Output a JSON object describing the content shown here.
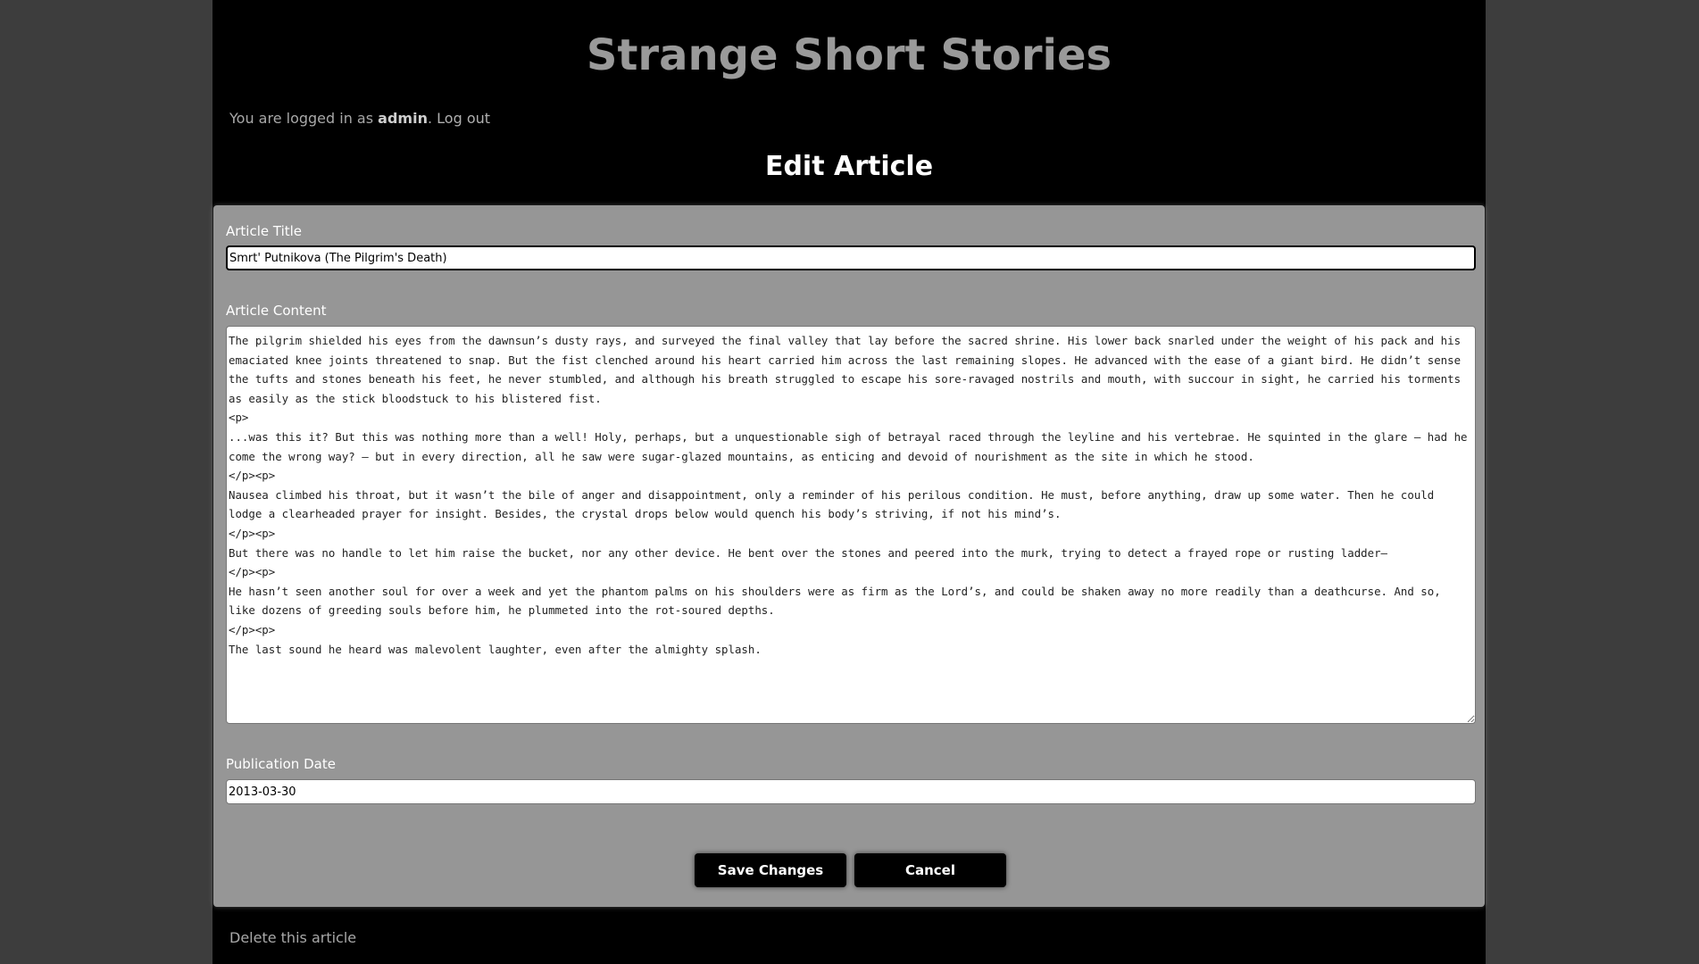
{
  "site": {
    "title": "Strange Short Stories"
  },
  "login": {
    "prefix": "You are logged in as",
    "username": "admin",
    "separator": ".",
    "logout_label": "Log out"
  },
  "page": {
    "heading": "Edit Article"
  },
  "form": {
    "title_label": "Article Title",
    "title_value": "Smrt' Putnikova (The Pilgrim's Death)",
    "content_label": "Article Content",
    "content_value": "The pilgrim shielded his eyes from the dawnsun’s dusty rays, and surveyed the final valley that lay before the sacred shrine. His lower back snarled under the weight of his pack and his emaciated knee joints threatened to snap. But the fist clenched around his heart carried him across the last remaining slopes. He advanced with the ease of a giant bird. He didn’t sense the tufts and stones beneath his feet, he never stumbled, and although his breath struggled to escape his sore-ravaged nostrils and mouth, with succour in sight, he carried his torments as easily as the stick bloodstuck to his blistered fist.\n<p>\n...was this it? But this was nothing more than a well! Holy, perhaps, but a unquestionable sigh of betrayal raced through the leyline and his vertebrae. He squinted in the glare – had he come the wrong way? – but in every direction, all he saw were sugar-glazed mountains, as enticing and devoid of nourishment as the site in which he stood.\n</p><p>\nNausea climbed his throat, but it wasn’t the bile of anger and disappointment, only a reminder of his perilous condition. He must, before anything, draw up some water. Then he could lodge a clearheaded prayer for insight. Besides, the crystal drops below would quench his body’s striving, if not his mind’s.\n</p><p>\nBut there was no handle to let him raise the bucket, nor any other device. He bent over the stones and peered into the murk, trying to detect a frayed rope or rusting ladder–\n</p><p>\nHe hasn’t seen another soul for over a week and yet the phantom palms on his shoulders were as firm as the Lord’s, and could be shaken away no more readily than a deathcurse. And so, like dozens of greeding souls before him, he plummeted into the rot-soured depths.\n</p><p>\nThe last sound he heard was malevolent laughter, even after the almighty splash.",
    "date_label": "Publication Date",
    "date_value": "2013-03-30",
    "save_label": "Save Changes",
    "cancel_label": "Cancel"
  },
  "footer": {
    "delete_label": "Delete this article"
  }
}
